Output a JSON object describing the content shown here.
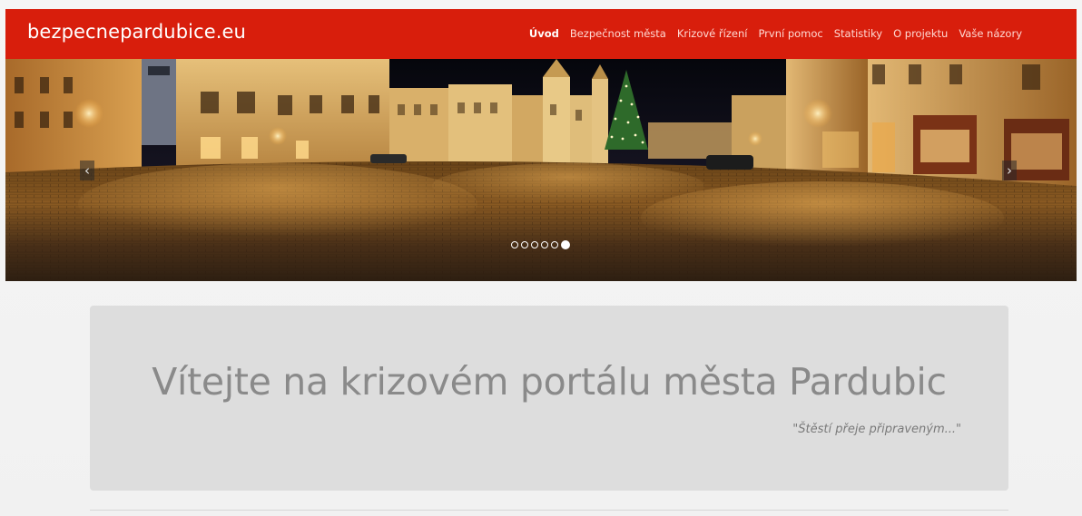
{
  "navbar": {
    "brand": "bezpecnepardubice.eu",
    "items": [
      {
        "label": "Úvod",
        "active": true
      },
      {
        "label": "Bezpečnost města",
        "active": false
      },
      {
        "label": "Krizové řízení",
        "active": false
      },
      {
        "label": "První pomoc",
        "active": false
      },
      {
        "label": "Statistiky",
        "active": false
      },
      {
        "label": "O projektu",
        "active": false
      },
      {
        "label": "Vaše názory",
        "active": false
      }
    ],
    "color": "#d81e0c"
  },
  "carousel": {
    "prev_icon": "chevron-left-icon",
    "next_icon": "chevron-right-icon",
    "prev_glyph": "‹",
    "next_glyph": "›",
    "slide_count": 6,
    "active_index": 5
  },
  "jumbotron": {
    "title": "Vítejte na krizovém portálu města Pardubic",
    "quote": "\"Štěstí přeje připraveným...\""
  }
}
